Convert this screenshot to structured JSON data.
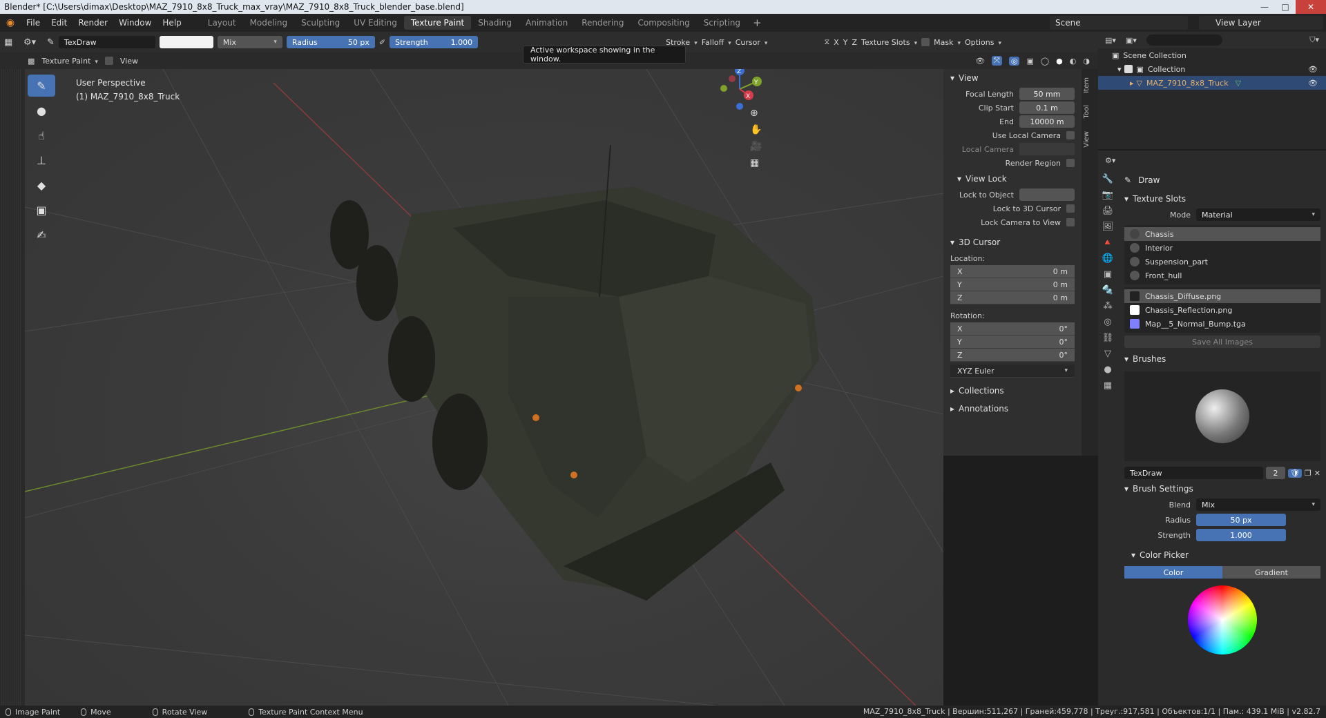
{
  "window": {
    "title": "Blender* [C:\\Users\\dimax\\Desktop\\MAZ_7910_8x8_Truck_max_vray\\MAZ_7910_8x8_Truck_blender_base.blend]",
    "min": "—",
    "max": "□",
    "close": "✕"
  },
  "menu": [
    "File",
    "Edit",
    "Render",
    "Window",
    "Help"
  ],
  "workspaces": [
    "Layout",
    "Modeling",
    "Sculpting",
    "UV Editing",
    "Texture Paint",
    "Shading",
    "Animation",
    "Rendering",
    "Compositing",
    "Scripting"
  ],
  "workspace_active_index": 4,
  "workspace_add": "+",
  "scene": "Scene",
  "view_layer": "View Layer",
  "tool_header": {
    "brush_name": "TexDraw",
    "blend": "Mix",
    "radius_label": "Radius",
    "radius_value": "50 px",
    "strength_label": "Strength",
    "strength_value": "1.000",
    "stroke": "Stroke",
    "falloff": "Falloff",
    "cursor": "Cursor",
    "axes": [
      "X",
      "Y",
      "Z"
    ],
    "texture_slots": "Texture Slots",
    "mask": "Mask",
    "options": "Options"
  },
  "sub_header": {
    "mode": "Texture Paint",
    "view": "View"
  },
  "tooltip": "Active workspace showing in the window.",
  "viewport": {
    "line1": "User Perspective",
    "line2": "(1) MAZ_7910_8x8_Truck",
    "gizmo": {
      "x": "X",
      "y": "Y",
      "z": "Z"
    }
  },
  "npanel": {
    "view_header": "View",
    "focal_length_label": "Focal Length",
    "focal_length": "50 mm",
    "clip_start_label": "Clip Start",
    "clip_start": "0.1 m",
    "end_label": "End",
    "end": "10000 m",
    "use_local_camera": "Use Local Camera",
    "local_camera": "Local Camera",
    "render_region": "Render Region",
    "view_lock_header": "View Lock",
    "lock_to_object": "Lock to Object",
    "lock_to_3d_cursor": "Lock to 3D Cursor",
    "lock_camera_to_view": "Lock Camera to View",
    "cursor_header": "3D Cursor",
    "location_label": "Location:",
    "location": [
      {
        "axis": "X",
        "value": "0 m"
      },
      {
        "axis": "Y",
        "value": "0 m"
      },
      {
        "axis": "Z",
        "value": "0 m"
      }
    ],
    "rotation_label": "Rotation:",
    "rotation": [
      {
        "axis": "X",
        "value": "0°"
      },
      {
        "axis": "Y",
        "value": "0°"
      },
      {
        "axis": "Z",
        "value": "0°"
      }
    ],
    "rotation_mode": "XYZ Euler",
    "collections": "Collections",
    "annotations": "Annotations",
    "tabs": [
      "Item",
      "Tool",
      "View"
    ]
  },
  "outliner": {
    "scene_collection": "Scene Collection",
    "collection": "Collection",
    "object": "MAZ_7910_8x8_Truck"
  },
  "properties": {
    "tool_name": "Draw",
    "texture_slots_header": "Texture Slots",
    "mode_label": "Mode",
    "mode_value": "Material",
    "materials": [
      "Chassis",
      "Interior",
      "Suspension_part",
      "Front_hull"
    ],
    "images": [
      {
        "name": "Chassis_Diffuse.png",
        "color": "#222222"
      },
      {
        "name": "Chassis_Reflection.png",
        "color": "#ffffff"
      },
      {
        "name": "Map__5_Normal_Bump.tga",
        "color": "#8080ff"
      }
    ],
    "save_all_images": "Save All Images",
    "brushes_header": "Brushes",
    "brush_name": "TexDraw",
    "brush_users": "2",
    "brush_settings_header": "Brush Settings",
    "blend_label": "Blend",
    "blend_value": "Mix",
    "radius_label": "Radius",
    "radius_value": "50 px",
    "strength_label": "Strength",
    "strength_value": "1.000",
    "color_picker_header": "Color Picker",
    "color_tab": "Color",
    "gradient_tab": "Gradient"
  },
  "statusbar": {
    "image_paint": "Image Paint",
    "move": "Move",
    "rotate_view": "Rotate View",
    "context_menu": "Texture Paint Context Menu",
    "stats": "MAZ_7910_8x8_Truck | Вершин:511,267 | Граней:459,778 | Треуг.:917,581 | Объектов:1/1 | Пам.: 439.1 MiB | v2.82.7"
  },
  "colors": {
    "accent": "#4772b3",
    "selection": "#2f4a75",
    "object_label": "#e8b06a"
  }
}
